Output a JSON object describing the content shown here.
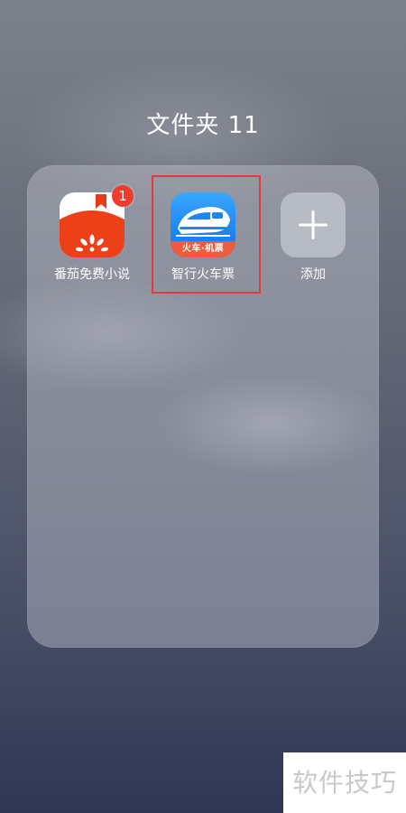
{
  "folder": {
    "title": "文件夹 11"
  },
  "apps": [
    {
      "label": "番茄免费小说",
      "badge": "1",
      "icon": "tomato-novel-icon"
    },
    {
      "label": "智行火车票",
      "icon": "train-ticket-icon",
      "ribbon_text": "火车·机票"
    },
    {
      "label": "添加",
      "icon": "plus-icon"
    }
  ],
  "watermark": {
    "text": "软件技巧"
  },
  "colors": {
    "highlight": "#e23b3b",
    "badge": "#f23b2f",
    "tomato_red": "#e53a15",
    "train_blue": "#1d86f0",
    "train_ribbon": "#f05a3d"
  }
}
